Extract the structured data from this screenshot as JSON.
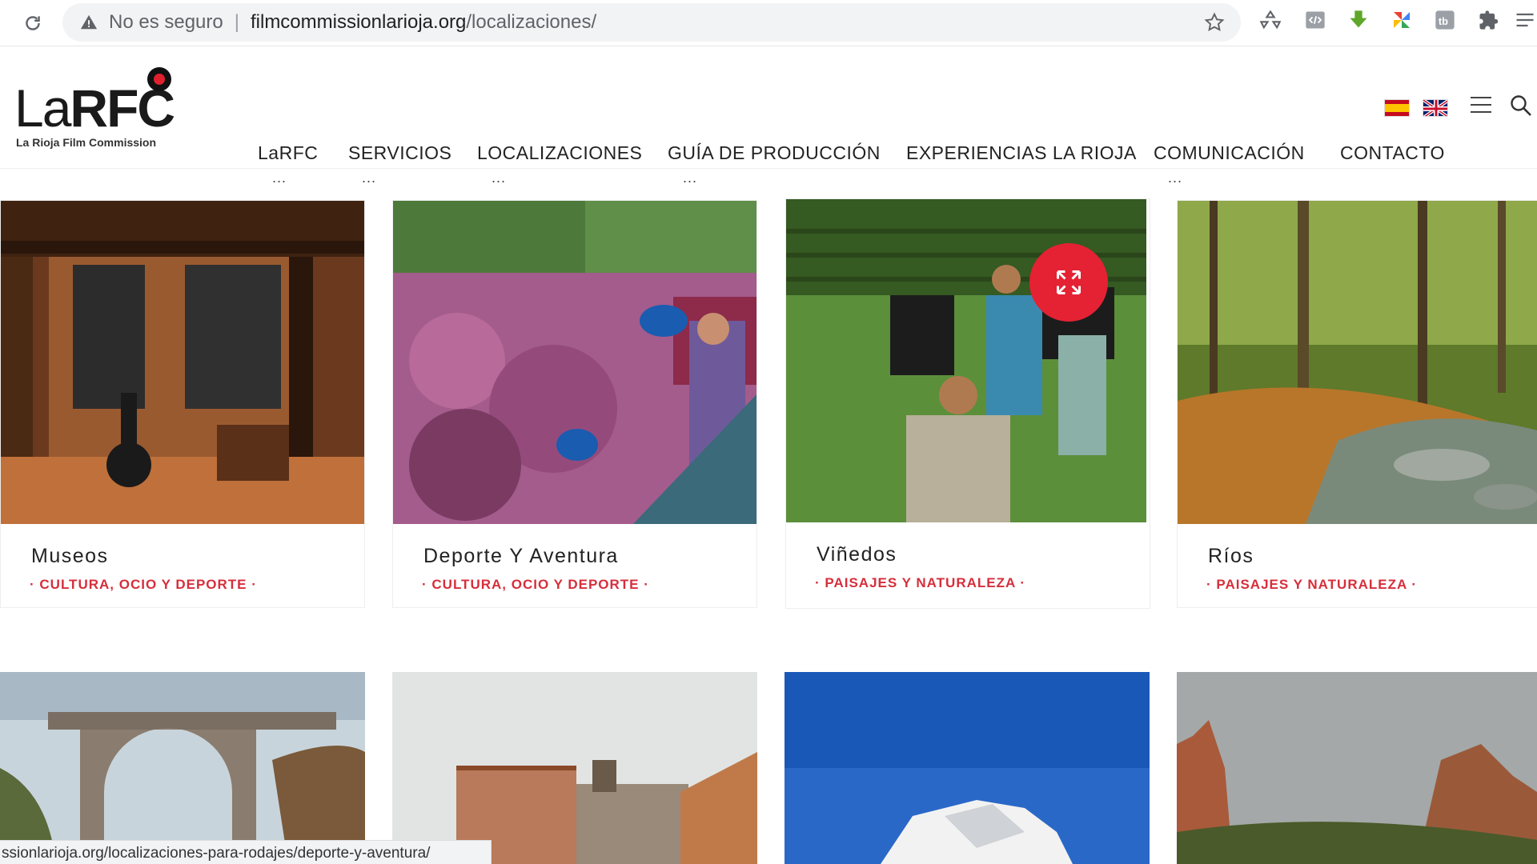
{
  "browser": {
    "security_label": "No es seguro",
    "url_host": "filmcommissionlarioja.org",
    "url_path": "/localizaciones/",
    "status_url": "ssionlarioja.org/localizaciones-para-rodajes/deporte-y-aventura/"
  },
  "site": {
    "logo_text_light": "La",
    "logo_text_bold": "RFC",
    "logo_tagline": "La Rioja Film Commission",
    "nav": [
      {
        "label": "LaRFC",
        "dots": "..."
      },
      {
        "label": "SERVICIOS",
        "dots": "..."
      },
      {
        "label": "LOCALIZACIONES",
        "dots": "..."
      },
      {
        "label": "GUÍA DE PRODUCCIÓN",
        "dots": "..."
      },
      {
        "label": "EXPERIENCIAS LA RIOJA",
        "dots": ""
      },
      {
        "label": "COMUNICACIÓN",
        "dots": "..."
      },
      {
        "label": "CONTACTO",
        "dots": ""
      }
    ]
  },
  "cards": [
    {
      "title": "Museos",
      "category": "· CULTURA, OCIO Y DEPORTE ·"
    },
    {
      "title": "Deporte Y Aventura",
      "category": "· CULTURA, OCIO Y DEPORTE ·"
    },
    {
      "title": "Viñedos",
      "category": "· PAISAJES Y NATURALEZA ·"
    },
    {
      "title": "Ríos",
      "category": "· PAISAJES Y NATURALEZA ·"
    }
  ],
  "colors": {
    "accent": "#d62e3b",
    "expand_button": "#e42233"
  }
}
